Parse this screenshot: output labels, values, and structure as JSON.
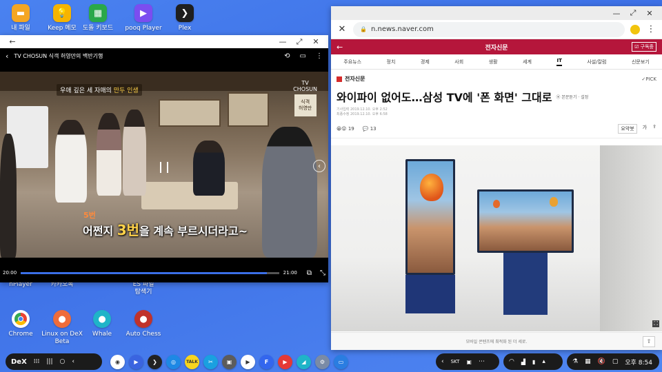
{
  "desktop": {
    "top_icons": [
      {
        "label": "내 파일",
        "icon": "folder-icon",
        "color": "#f4a623",
        "glyph": "▬"
      },
      {
        "label": "Keep 메모",
        "icon": "lightbulb-icon",
        "color": "#f6b400",
        "glyph": "💡"
      },
      {
        "label": "도돌 키보드",
        "icon": "keyboard-icon",
        "color": "#2aa84a",
        "glyph": "▦"
      },
      {
        "label": "pooq Player",
        "icon": "pooq-player-icon",
        "color": "#7b4df0",
        "glyph": "▶"
      },
      {
        "label": "Plex",
        "icon": "plex-icon",
        "color": "#1f1f1f",
        "glyph": "❯"
      }
    ],
    "mid_icons": [
      {
        "label": "nPlayer"
      },
      {
        "label": "카카오톡"
      },
      {
        "label": "ES 파일\n탐색기"
      }
    ],
    "bottom_icons": [
      {
        "label": "Chrome",
        "icon": "chrome-icon",
        "color": "#ffffff"
      },
      {
        "label": "Linux on DeX Beta",
        "icon": "linux-dex-icon",
        "color": "#ef6c3a"
      },
      {
        "label": "Whale",
        "icon": "whale-icon",
        "color": "#1fb4c8"
      },
      {
        "label": "Auto Chess",
        "icon": "auto-chess-icon",
        "color": "#c0322b"
      }
    ]
  },
  "video_player": {
    "title": "TV CHOSUN 식객 허영만의 백반기행",
    "caption_top_pre": "우애 깊은 세 자매의",
    "caption_top_hl": "만두 인생",
    "subtitle_num": "5번",
    "subtitle_pre": "어쩐지",
    "subtitle_acc": "3번",
    "subtitle_post": "을 계속 부르시더라고~",
    "channel": "TV\nCHOSUN",
    "channel_box": "식객\n허영만",
    "time_current": "20:00",
    "time_total": "21:00",
    "progress": 0.952
  },
  "browser": {
    "url": "n.news.naver.com",
    "section_title": "전자신문",
    "subscribe": "구독중",
    "categories": [
      "주요뉴스",
      "정치",
      "경제",
      "사회",
      "생활",
      "세계",
      "IT",
      "사설/칼럼",
      "신문보기"
    ],
    "active_category": "IT",
    "press": "전자신문",
    "pick": "✓PICK",
    "headline": "와이파이 없어도…삼성 TV에 '폰 화면' 그대로",
    "headline_orig": "본문듣기 · 설정",
    "meta_input": "기사입력 2019.12.10. 오후 2:52",
    "meta_edit": "최종수정 2019.12.10. 오후 6:58",
    "likes": "19",
    "comments": "13",
    "summary": "요약봇",
    "font_size": "가",
    "footer": "모바일 콘텐츠에 최적화 된 더 세로."
  },
  "taskbar": {
    "dex_label": "DeX",
    "carrier": "SKT",
    "clock": "오후 8:54",
    "apps": [
      {
        "icon": "chrome-icon",
        "color": "#ffffff",
        "glyph": "◉"
      },
      {
        "icon": "video-player-icon",
        "color": "#3a64e0",
        "glyph": "▶"
      },
      {
        "icon": "plex-icon",
        "color": "#222222",
        "glyph": "❯"
      },
      {
        "icon": "browser-icon",
        "color": "#1e88e5",
        "glyph": "◎"
      },
      {
        "icon": "kakaotalk-icon",
        "color": "#f7d51e",
        "glyph": "TALK"
      },
      {
        "icon": "video-editor-icon",
        "color": "#1aa0e0",
        "glyph": "✂"
      },
      {
        "icon": "gallery-icon",
        "color": "#5c5c5c",
        "glyph": "▣"
      },
      {
        "icon": "play-store-icon",
        "color": "#ffffff",
        "glyph": "▶"
      },
      {
        "icon": "f-app-icon",
        "color": "#3366ee",
        "glyph": "F"
      },
      {
        "icon": "youtube-icon",
        "color": "#e53935",
        "glyph": "▶"
      },
      {
        "icon": "whale-icon",
        "color": "#1fb4c8",
        "glyph": "◢"
      },
      {
        "icon": "settings-icon",
        "color": "#7a8ba6",
        "glyph": "⚙"
      },
      {
        "icon": "samsung-app-icon",
        "color": "#2a7de1",
        "glyph": "▭"
      }
    ]
  }
}
